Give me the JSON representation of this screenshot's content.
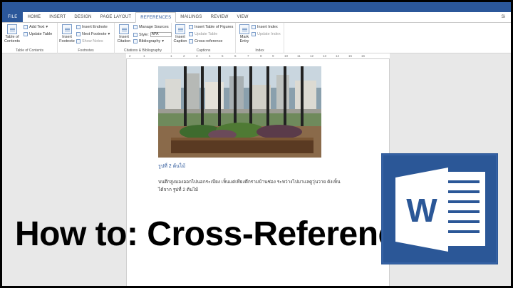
{
  "tabs": [
    {
      "label": "FILE"
    },
    {
      "label": "HOME"
    },
    {
      "label": "INSERT"
    },
    {
      "label": "DESIGN"
    },
    {
      "label": "PAGE LAYOUT"
    },
    {
      "label": "REFERENCES"
    },
    {
      "label": "MAILINGS"
    },
    {
      "label": "REVIEW"
    },
    {
      "label": "VIEW"
    }
  ],
  "signin": "Si",
  "ribbon": {
    "toc": {
      "btn": "Table of Contents",
      "add_text": "Add Text",
      "update_table": "Update Table",
      "label": "Table of Contents"
    },
    "footnotes": {
      "insert_footnote": "Insert Footnote",
      "insert_endnote": "Insert Endnote",
      "next_footnote": "Next Footnote",
      "show_notes": "Show Notes",
      "label": "Footnotes"
    },
    "citations": {
      "insert_citation": "Insert Citation",
      "manage_sources": "Manage Sources",
      "style_label": "Style:",
      "style_value": "APA",
      "bibliography": "Bibliography",
      "label": "Citations & Bibliography"
    },
    "captions": {
      "insert_caption": "Insert Caption",
      "insert_tof": "Insert Table of Figures",
      "update_table": "Update Table",
      "cross_reference": "Cross-reference",
      "label": "Captions"
    },
    "index": {
      "mark_entry": "Mark Entry",
      "insert_index": "Insert Index",
      "update_index": "Update Index",
      "label": "Index"
    }
  },
  "ruler": [
    "2",
    "1",
    "1",
    "2",
    "3",
    "4",
    "5",
    "6",
    "7",
    "8",
    "9",
    "10",
    "11",
    "12",
    "13",
    "14",
    "15",
    "16"
  ],
  "document": {
    "caption": "รูปที่ 2 ต้นไม้",
    "paragraph_line1": "บนตึกสูงมองออกไปนอกระเบียง เห็นแต่เทียงตึกรามบ้านช่อง ระหว่างไปมาแลดูวุ่นวาย ดังเห็น",
    "paragraph_line2": "ได้จาก รูปที่ 2 ต้นไม้"
  },
  "headline": "How to: Cross-Reference",
  "logo": {
    "letter": "W"
  },
  "colors": {
    "word_blue": "#2b579a",
    "logo_blue": "#2b5797"
  }
}
